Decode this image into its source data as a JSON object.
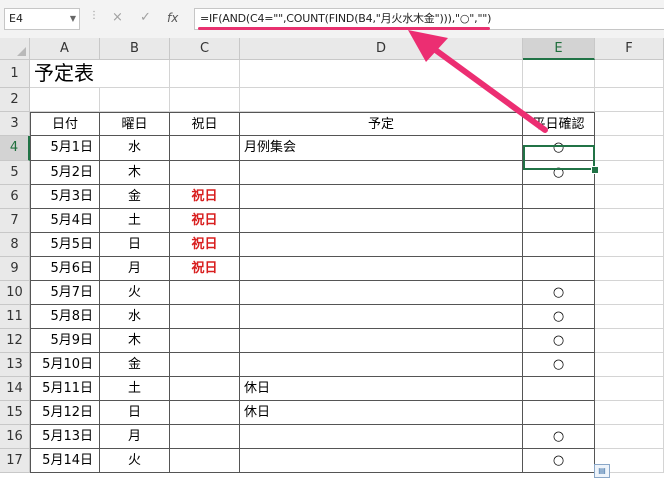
{
  "name_box": "E4",
  "formula_bar": {
    "cancel_icon": "×",
    "enter_icon": "✓",
    "fx_icon": "fx",
    "formula": "=IF(AND(C4=\"\",COUNT(FIND(B4,\"月火水木金\"))),\"○\",\"\")"
  },
  "columns": [
    "A",
    "B",
    "C",
    "D",
    "E",
    "F"
  ],
  "rows": [
    "1",
    "2",
    "3",
    "4",
    "5",
    "6",
    "7",
    "8",
    "9",
    "10",
    "11",
    "12",
    "13",
    "14",
    "15",
    "16",
    "17"
  ],
  "sheet": {
    "title": "予定表",
    "headers": [
      "日付",
      "曜日",
      "祝日",
      "予定",
      "平日確認"
    ],
    "data": [
      {
        "date": "5月1日",
        "weekday": "水",
        "holiday": "",
        "plan": "月例集会",
        "check": "○"
      },
      {
        "date": "5月2日",
        "weekday": "木",
        "holiday": "",
        "plan": "",
        "check": "○"
      },
      {
        "date": "5月3日",
        "weekday": "金",
        "holiday": "祝日",
        "plan": "",
        "check": ""
      },
      {
        "date": "5月4日",
        "weekday": "土",
        "holiday": "祝日",
        "plan": "",
        "check": ""
      },
      {
        "date": "5月5日",
        "weekday": "日",
        "holiday": "祝日",
        "plan": "",
        "check": ""
      },
      {
        "date": "5月6日",
        "weekday": "月",
        "holiday": "祝日",
        "plan": "",
        "check": ""
      },
      {
        "date": "5月7日",
        "weekday": "火",
        "holiday": "",
        "plan": "",
        "check": "○"
      },
      {
        "date": "5月8日",
        "weekday": "水",
        "holiday": "",
        "plan": "",
        "check": "○"
      },
      {
        "date": "5月9日",
        "weekday": "木",
        "holiday": "",
        "plan": "",
        "check": "○"
      },
      {
        "date": "5月10日",
        "weekday": "金",
        "holiday": "",
        "plan": "",
        "check": "○"
      },
      {
        "date": "5月11日",
        "weekday": "土",
        "holiday": "",
        "plan": "休日",
        "check": ""
      },
      {
        "date": "5月12日",
        "weekday": "日",
        "holiday": "",
        "plan": "休日",
        "check": ""
      },
      {
        "date": "5月13日",
        "weekday": "月",
        "holiday": "",
        "plan": "",
        "check": "○"
      },
      {
        "date": "5月14日",
        "weekday": "火",
        "holiday": "",
        "plan": "",
        "check": "○"
      }
    ]
  },
  "selected_cell": "E4",
  "colors": {
    "accent": "#217346",
    "highlight": "#e8316f",
    "holiday": "#d81e1e"
  }
}
